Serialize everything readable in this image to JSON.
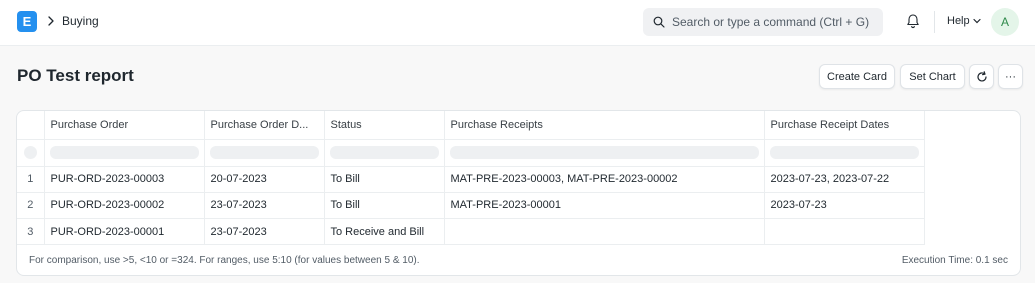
{
  "navbar": {
    "logo_letter": "E",
    "breadcrumb": "Buying",
    "search_placeholder": "Search or type a command (Ctrl + G)",
    "help_label": "Help",
    "avatar_letter": "A"
  },
  "page": {
    "title": "PO Test report",
    "create_card_label": "Create Card",
    "set_chart_label": "Set Chart",
    "more_label": "···"
  },
  "table": {
    "columns": [
      "Purchase Order",
      "Purchase Order D...",
      "Status",
      "Purchase Receipts",
      "Purchase Receipt Dates"
    ],
    "rows": [
      {
        "num": "1",
        "po": "PUR-ORD-2023-00003",
        "date": "20-07-2023",
        "status": "To Bill",
        "receipts": "MAT-PRE-2023-00003, MAT-PRE-2023-00002",
        "receipt_dates": "2023-07-23, 2023-07-22"
      },
      {
        "num": "2",
        "po": "PUR-ORD-2023-00002",
        "date": "23-07-2023",
        "status": "To Bill",
        "receipts": "MAT-PRE-2023-00001",
        "receipt_dates": "2023-07-23"
      },
      {
        "num": "3",
        "po": "PUR-ORD-2023-00001",
        "date": "23-07-2023",
        "status": "To Receive and Bill",
        "receipts": "",
        "receipt_dates": ""
      }
    ]
  },
  "footer": {
    "note": "For comparison, use >5, <10 or =324. For ranges, use 5:10 (for values between 5 & 10).",
    "execution_time": "Execution Time: 0.1 sec"
  }
}
